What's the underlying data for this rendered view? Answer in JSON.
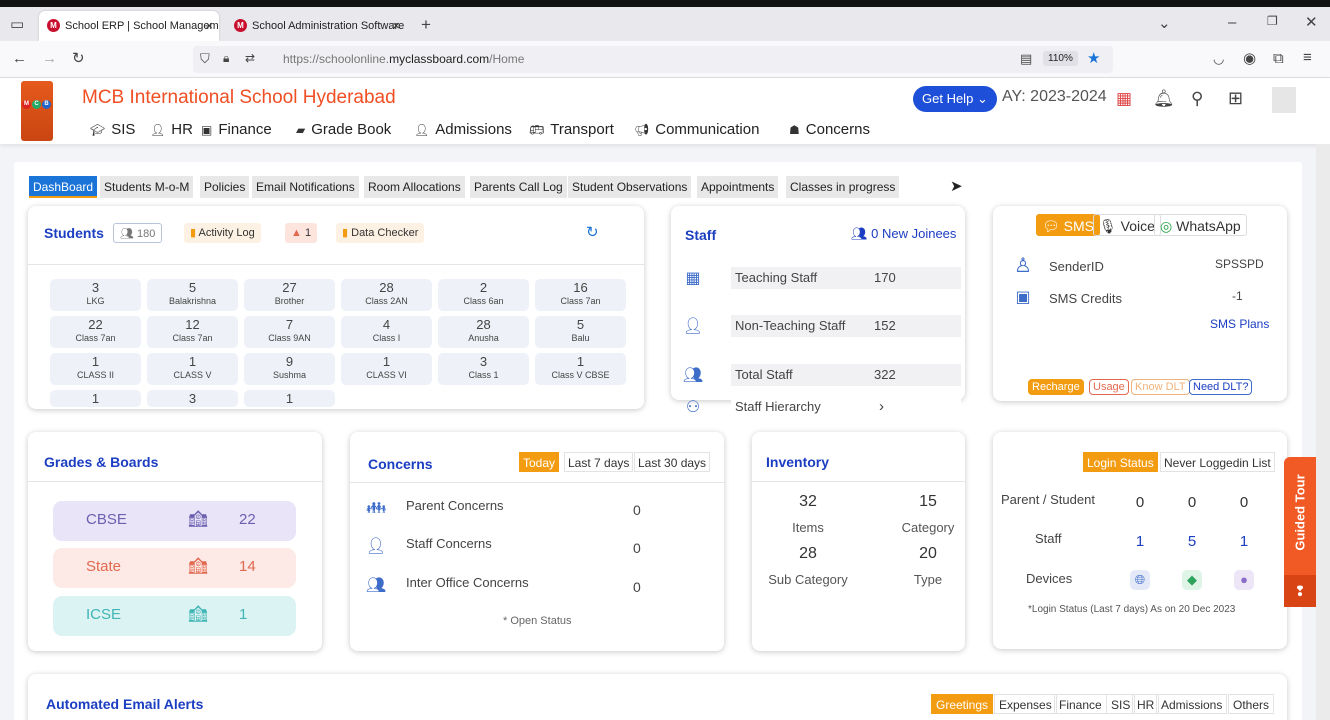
{
  "browser": {
    "tabs": [
      {
        "title": "School ERP | School Manageme",
        "favicon": "M"
      },
      {
        "title": "School Administration Software",
        "favicon": "M"
      }
    ],
    "url_prefix": "https://schoolonline.",
    "url_domain": "myclassboard.com",
    "url_path": "/Home",
    "zoom": "110%"
  },
  "header": {
    "school_name": "MCB International School Hyderabad",
    "nav": [
      "SIS",
      "HR",
      "Finance",
      "Grade Book",
      "Admissions",
      "Transport",
      "Communication",
      "Concerns"
    ],
    "get_help": "Get Help",
    "academic_year": "AY: 2023-2024",
    "logo_letters": [
      "M",
      "C",
      "B"
    ]
  },
  "subtabs": [
    "DashBoard",
    "Students M-o-M",
    "Policies",
    "Email Notifications",
    "Room Allocations",
    "Parents Call Log",
    "Student Observations",
    "Appointments",
    "Classes in progress"
  ],
  "students": {
    "title": "Students",
    "count": "180",
    "activity_log": "Activity Log",
    "alert_count": "1",
    "data_checker": "Data Checker",
    "cells": [
      {
        "n": "3",
        "l": "LKG"
      },
      {
        "n": "5",
        "l": "Balakrishna"
      },
      {
        "n": "27",
        "l": "Brother"
      },
      {
        "n": "28",
        "l": "Class 2AN"
      },
      {
        "n": "2",
        "l": "Class 6an"
      },
      {
        "n": "16",
        "l": "Class 7an"
      },
      {
        "n": "22",
        "l": "Class 7an"
      },
      {
        "n": "12",
        "l": "Class 7an"
      },
      {
        "n": "7",
        "l": "Class 9AN"
      },
      {
        "n": "4",
        "l": "Class I"
      },
      {
        "n": "28",
        "l": "Anusha"
      },
      {
        "n": "5",
        "l": "Balu"
      },
      {
        "n": "1",
        "l": "CLASS II"
      },
      {
        "n": "1",
        "l": "CLASS V"
      },
      {
        "n": "9",
        "l": "Sushma"
      },
      {
        "n": "1",
        "l": "CLASS VI"
      },
      {
        "n": "3",
        "l": "Class 1"
      },
      {
        "n": "1",
        "l": "Class V CBSE"
      },
      {
        "n": "1",
        "l": ""
      },
      {
        "n": "3",
        "l": ""
      },
      {
        "n": "1",
        "l": ""
      }
    ]
  },
  "staff": {
    "title": "Staff",
    "new_joinees": "0 New Joinees",
    "rows": [
      {
        "label": "Teaching Staff",
        "value": "170"
      },
      {
        "label": "Non-Teaching Staff",
        "value": "152"
      },
      {
        "label": "Total Staff",
        "value": "322"
      }
    ],
    "hierarchy": "Staff Hierarchy"
  },
  "sms": {
    "channels": [
      "SMS",
      "Voice",
      "WhatsApp"
    ],
    "sender_label": "SenderID",
    "sender_value": "SPSSPD",
    "credits_label": "SMS Credits",
    "credits_value": "-1",
    "plans": "SMS Plans",
    "tags": [
      "Recharge",
      "Usage",
      "Know DLT",
      "Need DLT?"
    ]
  },
  "grades": {
    "title": "Grades & Boards",
    "boards": [
      {
        "name": "CBSE",
        "value": "22",
        "color": "#e9e4f7",
        "text": "#6b5fb0"
      },
      {
        "name": "State",
        "value": "14",
        "color": "#fde9e5",
        "text": "#e2694f"
      },
      {
        "name": "ICSE",
        "value": "1",
        "color": "#dcf3f3",
        "text": "#3fb5b5"
      }
    ]
  },
  "concerns": {
    "title": "Concerns",
    "periods": [
      "Today",
      "Last 7 days",
      "Last 30 days"
    ],
    "rows": [
      {
        "label": "Parent Concerns",
        "value": "0"
      },
      {
        "label": "Staff Concerns",
        "value": "0"
      },
      {
        "label": "Inter Office Concerns",
        "value": "0"
      }
    ],
    "note": "* Open Status"
  },
  "inventory": {
    "title": "Inventory",
    "items": [
      {
        "value": "32",
        "label": "Items"
      },
      {
        "value": "15",
        "label": "Category"
      },
      {
        "value": "28",
        "label": "Sub Category"
      },
      {
        "value": "20",
        "label": "Type"
      }
    ]
  },
  "login": {
    "tabs": [
      "Login Status",
      "Never Loggedin List"
    ],
    "rows": [
      {
        "label": "Parent / Student",
        "values": [
          "0",
          "0",
          "0"
        ]
      },
      {
        "label": "Staff",
        "values": [
          "1",
          "5",
          "1"
        ]
      },
      {
        "label": "Devices",
        "values": []
      }
    ],
    "note": "*Login Status (Last 7 days) As on 20 Dec 2023"
  },
  "email_alerts": {
    "title": "Automated Email Alerts",
    "tabs": [
      "Greetings",
      "Expenses",
      "Finance",
      "SIS",
      "HR",
      "Admissions",
      "Others"
    ]
  },
  "guided_tour": "Guided Tour",
  "colors": {
    "accent": "#1b74d8",
    "brand": "#f04e23",
    "title_blue": "#1b3ec2",
    "orange": "#f39c12"
  }
}
